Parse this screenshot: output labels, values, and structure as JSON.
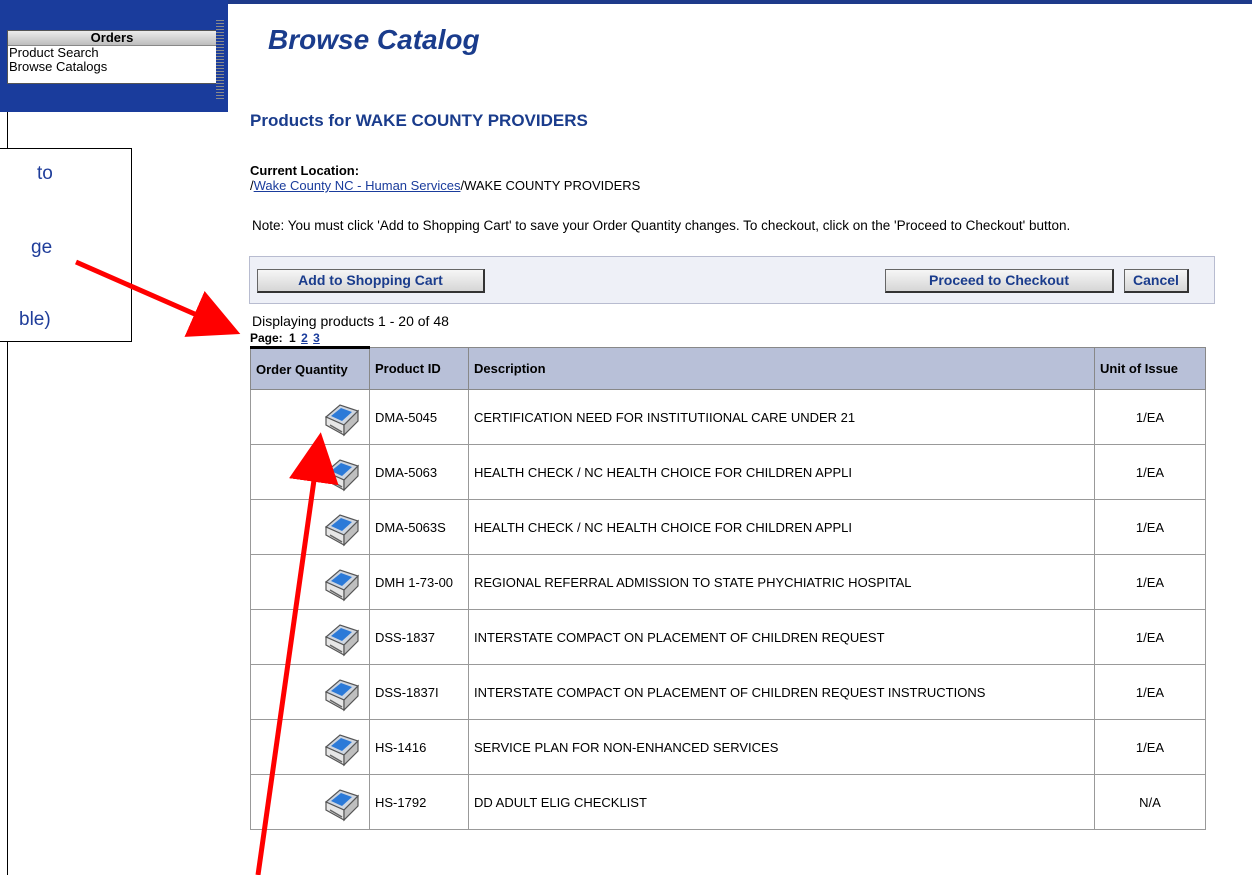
{
  "sidebar": {
    "title": "Orders",
    "items": [
      {
        "label": "Product Search"
      },
      {
        "label": "Browse Catalogs"
      }
    ]
  },
  "callout": {
    "lines": [
      "to",
      "ge",
      "ble)"
    ]
  },
  "header": {
    "title": "Browse Catalog"
  },
  "products_heading": "Products for WAKE COUNTY PROVIDERS",
  "location": {
    "label": "Current Location:",
    "prefix": "/",
    "link": "Wake County NC - Human Services",
    "suffix": "/WAKE COUNTY PROVIDERS"
  },
  "note": "Note: You must click 'Add to Shopping Cart' to save your Order Quantity changes. To checkout, click on the 'Proceed to Checkout' button.",
  "toolbar": {
    "add_label": "Add to Shopping Cart",
    "checkout_label": "Proceed to Checkout",
    "cancel_label": "Cancel"
  },
  "display_count": "Displaying products 1 - 20 of 48",
  "pager": {
    "label": "Page:",
    "current": "1",
    "pages": [
      "2",
      "3"
    ]
  },
  "table": {
    "columns": [
      "Order Quantity",
      "Product ID",
      "Description",
      "Unit of Issue"
    ],
    "rows": [
      {
        "id": "DMA-5045",
        "desc": "CERTIFICATION NEED FOR INSTITUTIIONAL CARE UNDER 21",
        "unit": "1/EA"
      },
      {
        "id": "DMA-5063",
        "desc": "HEALTH CHECK / NC HEALTH CHOICE FOR CHILDREN APPLI",
        "unit": "1/EA"
      },
      {
        "id": "DMA-5063S",
        "desc": "HEALTH CHECK / NC HEALTH CHOICE FOR CHILDREN APPLI",
        "unit": "1/EA"
      },
      {
        "id": "DMH 1-73-00",
        "desc": "REGIONAL REFERRAL ADMISSION TO STATE PHYCHIATRIC HOSPITAL",
        "unit": "1/EA"
      },
      {
        "id": "DSS-1837",
        "desc": "INTERSTATE COMPACT ON PLACEMENT OF CHILDREN REQUEST",
        "unit": "1/EA"
      },
      {
        "id": "DSS-1837I",
        "desc": "INTERSTATE COMPACT ON PLACEMENT OF CHILDREN REQUEST INSTRUCTIONS",
        "unit": "1/EA"
      },
      {
        "id": "HS-1416",
        "desc": "SERVICE PLAN FOR NON-ENHANCED SERVICES",
        "unit": "1/EA"
      },
      {
        "id": "HS-1792",
        "desc": "DD ADULT ELIG CHECKLIST",
        "unit": "N/A"
      }
    ]
  },
  "colors": {
    "brand_blue": "#1a3c9c",
    "header_text": "#1a3c8c",
    "table_header": "#b8c0d8",
    "annotation_arrow": "#ff0000"
  },
  "icons": {
    "order_quantity": "printer-icon"
  }
}
